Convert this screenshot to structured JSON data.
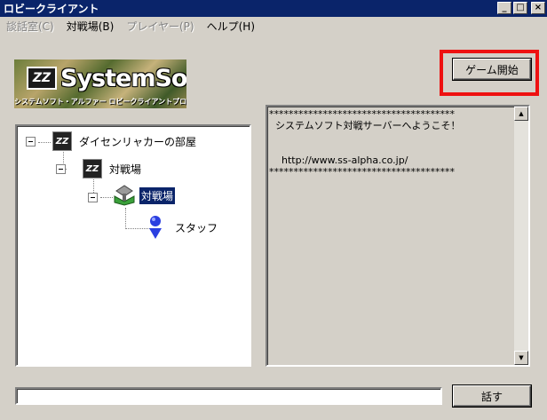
{
  "window": {
    "title": "ロビークライアント",
    "minimize_glyph": "_",
    "maximize_glyph": "□",
    "close_glyph": "×"
  },
  "menu": {
    "items": [
      {
        "label": "談話室(C)",
        "enabled": false
      },
      {
        "label": "対戦場(B)",
        "enabled": true
      },
      {
        "label": "プレイヤー(P)",
        "enabled": false
      },
      {
        "label": "ヘルプ(H)",
        "enabled": true
      }
    ]
  },
  "logo": {
    "mark": "ZZ",
    "text": "SystemSoft",
    "subtitle": "システムソフト・アルファー ロビークライアントプログラム"
  },
  "buttons": {
    "start_game": "ゲーム開始",
    "talk": "話す"
  },
  "tree": {
    "root": {
      "label": "ダイセンリャカーの部屋",
      "icon": "zz-room-icon"
    },
    "level1": {
      "label": "対戦場",
      "icon": "zz-room-icon"
    },
    "level2": {
      "label": "対戦場",
      "icon": "battle-field-icon",
      "selected": true
    },
    "level3": {
      "label": "スタッフ",
      "icon": "staff-person-icon"
    }
  },
  "messages": {
    "text": "**************************************\n  システムソフト対戦サーバーへようこそ！\n\n\n    http://www.ss-alpha.co.jp/\n**************************************"
  },
  "input": {
    "value": ""
  },
  "colors": {
    "titlebar": "#0a246a",
    "window_bg": "#d4d0c8",
    "highlight_frame": "#ee1111",
    "selection": "#0a246a"
  }
}
